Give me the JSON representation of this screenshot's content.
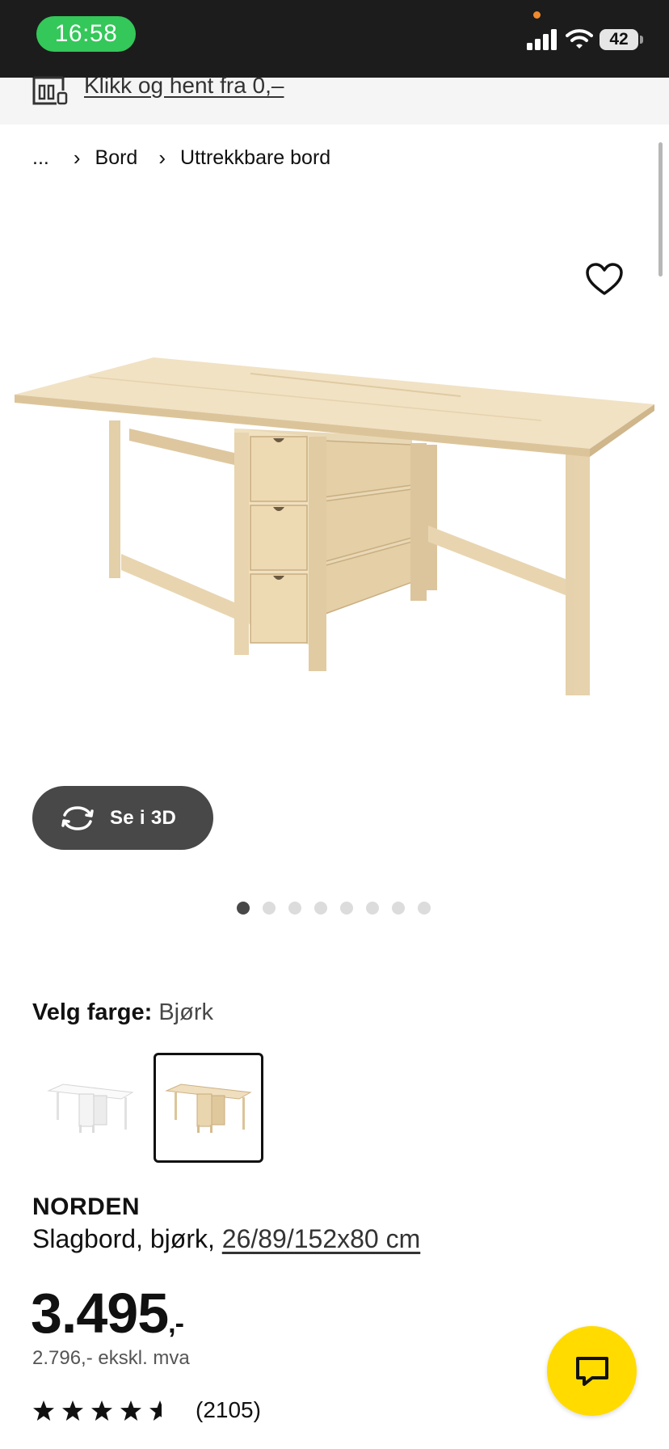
{
  "status_bar": {
    "time": "16:58",
    "battery": "42"
  },
  "promo": {
    "link_text": "Klikk og hent fra 0,–"
  },
  "breadcrumb": {
    "items": [
      "...",
      "Bord",
      "Uttrekkbare bord"
    ]
  },
  "gallery": {
    "view_3d_label": "Se i 3D",
    "image_count": 8,
    "active_index": 0
  },
  "color_picker": {
    "label": "Velg farge:",
    "selected": "Bjørk",
    "options": [
      "hvit",
      "bjørk"
    ]
  },
  "product": {
    "name": "NORDEN",
    "description": "Slagbord, bjørk,",
    "dimensions": "26/89/152x80 cm",
    "price": "3.495",
    "price_suffix": ",-",
    "price_ex_vat": "2.796,- ekskl. mva",
    "rating_stars": 4.5,
    "rating_count": "(2105)"
  },
  "colors": {
    "status_bar_bg": "#1c1c1c",
    "time_pill": "#34c759",
    "chat_button": "#ffdb00",
    "dark_button": "#484848"
  },
  "icons": [
    "signal-icon",
    "wifi-icon",
    "battery-icon",
    "store-icon",
    "heart-icon",
    "rotate-3d-icon",
    "star-icon",
    "chat-icon"
  ]
}
